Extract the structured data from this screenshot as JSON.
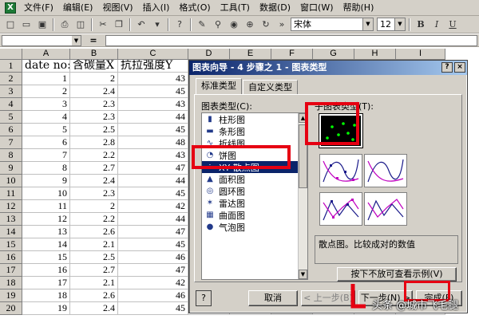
{
  "menu": {
    "items": [
      "文件(F)",
      "编辑(E)",
      "视图(V)",
      "插入(I)",
      "格式(O)",
      "工具(T)",
      "数据(D)",
      "窗口(W)",
      "帮助(H)"
    ]
  },
  "toolbar": {
    "font_name": "宋体",
    "font_size": "12",
    "bold": "B",
    "italic": "I",
    "underline": "U"
  },
  "formula": {
    "eq": "="
  },
  "sheet": {
    "columns": [
      "A",
      "B",
      "C",
      "D",
      "E",
      "F",
      "G",
      "H",
      "I"
    ],
    "rows": [
      {
        "n": "1",
        "a": "date no:",
        "b": "含碳量X",
        "c": "抗拉强度Y"
      },
      {
        "n": "2",
        "a": "1",
        "b": "2",
        "c": "43"
      },
      {
        "n": "3",
        "a": "2",
        "b": "2.4",
        "c": "45"
      },
      {
        "n": "4",
        "a": "3",
        "b": "2.3",
        "c": "43"
      },
      {
        "n": "5",
        "a": "4",
        "b": "2.3",
        "c": "44"
      },
      {
        "n": "6",
        "a": "5",
        "b": "2.5",
        "c": "45"
      },
      {
        "n": "7",
        "a": "6",
        "b": "2.8",
        "c": "48"
      },
      {
        "n": "8",
        "a": "7",
        "b": "2.2",
        "c": "43"
      },
      {
        "n": "9",
        "a": "8",
        "b": "2.7",
        "c": "47"
      },
      {
        "n": "10",
        "a": "9",
        "b": "2.4",
        "c": "44"
      },
      {
        "n": "11",
        "a": "10",
        "b": "2.3",
        "c": "45"
      },
      {
        "n": "12",
        "a": "11",
        "b": "2",
        "c": "42"
      },
      {
        "n": "13",
        "a": "12",
        "b": "2.2",
        "c": "44"
      },
      {
        "n": "14",
        "a": "13",
        "b": "2.6",
        "c": "47"
      },
      {
        "n": "15",
        "a": "14",
        "b": "2.1",
        "c": "45"
      },
      {
        "n": "16",
        "a": "15",
        "b": "2.5",
        "c": "46"
      },
      {
        "n": "17",
        "a": "16",
        "b": "2.7",
        "c": "47"
      },
      {
        "n": "18",
        "a": "17",
        "b": "2.1",
        "c": "42"
      },
      {
        "n": "19",
        "a": "18",
        "b": "2.6",
        "c": "46"
      },
      {
        "n": "20",
        "a": "19",
        "b": "2.4",
        "c": "45"
      }
    ]
  },
  "dialog": {
    "title": "图表向导 - 4 步骤之 1 - 图表类型",
    "title_help": "?",
    "title_close": "×",
    "tabs": [
      "标准类型",
      "自定义类型"
    ],
    "chart_type_label": "图表类型(C):",
    "subtype_label": "子图表类型(T):",
    "chart_types": [
      {
        "icon": "▮",
        "label": "柱形图"
      },
      {
        "icon": "▬",
        "label": "条形图"
      },
      {
        "icon": "∿",
        "label": "折线图"
      },
      {
        "icon": "◔",
        "label": "饼图"
      },
      {
        "icon": "⁘",
        "label": "XY 散点图"
      },
      {
        "icon": "▲",
        "label": "面积图"
      },
      {
        "icon": "◎",
        "label": "圆环图"
      },
      {
        "icon": "✶",
        "label": "雷达图"
      },
      {
        "icon": "▦",
        "label": "曲面图"
      },
      {
        "icon": "●",
        "label": "气泡图"
      }
    ],
    "description": "散点图。比较成对的数值",
    "press_label": "按下不放可查看示例(V)",
    "buttons": {
      "cancel": "取消",
      "back": "< 上一步(B)",
      "next": "下一步(N) >",
      "finish": "完成(F)"
    },
    "help_btn": "?"
  },
  "watermark": "头条 @城市飞毛腿"
}
